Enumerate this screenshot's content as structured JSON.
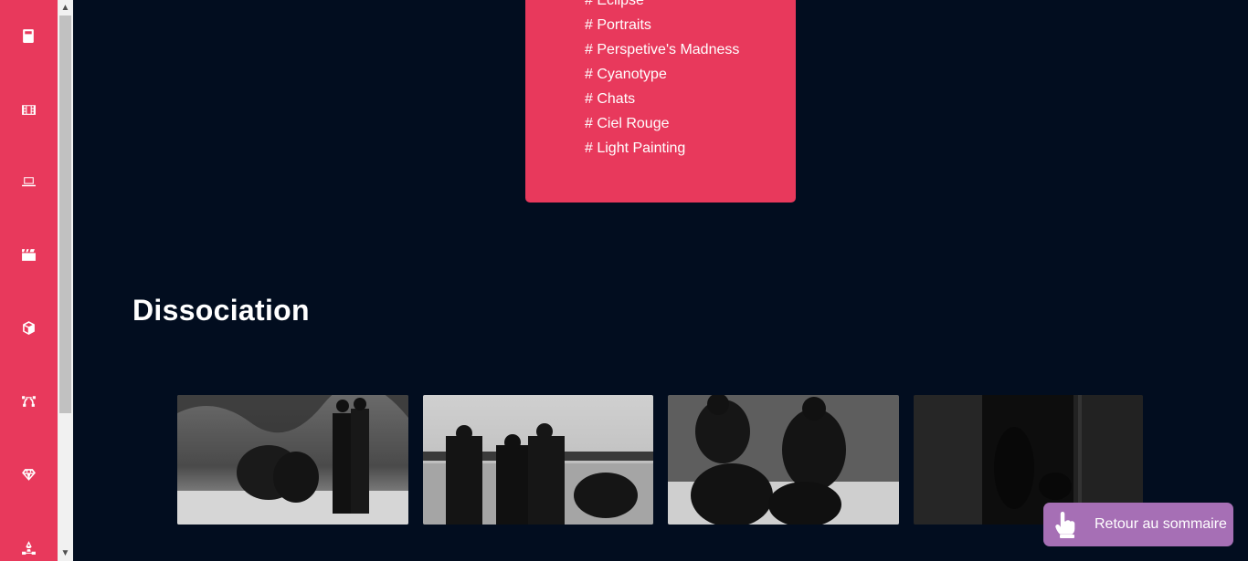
{
  "sidebar": {
    "items": [
      {
        "icon": "book-icon"
      },
      {
        "icon": "film-icon"
      },
      {
        "icon": "laptop-icon"
      },
      {
        "icon": "clapperboard-icon"
      },
      {
        "icon": "cube-icon"
      },
      {
        "icon": "vector-icon"
      },
      {
        "icon": "gem-icon"
      },
      {
        "icon": "pen-tool-icon"
      }
    ]
  },
  "tags": {
    "items": [
      "# Eclipse",
      "# Portraits",
      "# Perspetive's Madness",
      "# Cyanotype",
      "# Chats",
      "# Ciel Rouge",
      "# Light Painting"
    ]
  },
  "section": {
    "title": "Dissociation"
  },
  "gallery": {
    "photos": [
      {
        "name": "photo-1"
      },
      {
        "name": "photo-2"
      },
      {
        "name": "photo-3"
      },
      {
        "name": "photo-4"
      }
    ]
  },
  "back_button": {
    "label": "Retour au sommaire",
    "icon": "pointing-hand-icon"
  },
  "colors": {
    "background": "#020d1f",
    "accent": "#e8395c",
    "back_button": "#a66fb5"
  }
}
